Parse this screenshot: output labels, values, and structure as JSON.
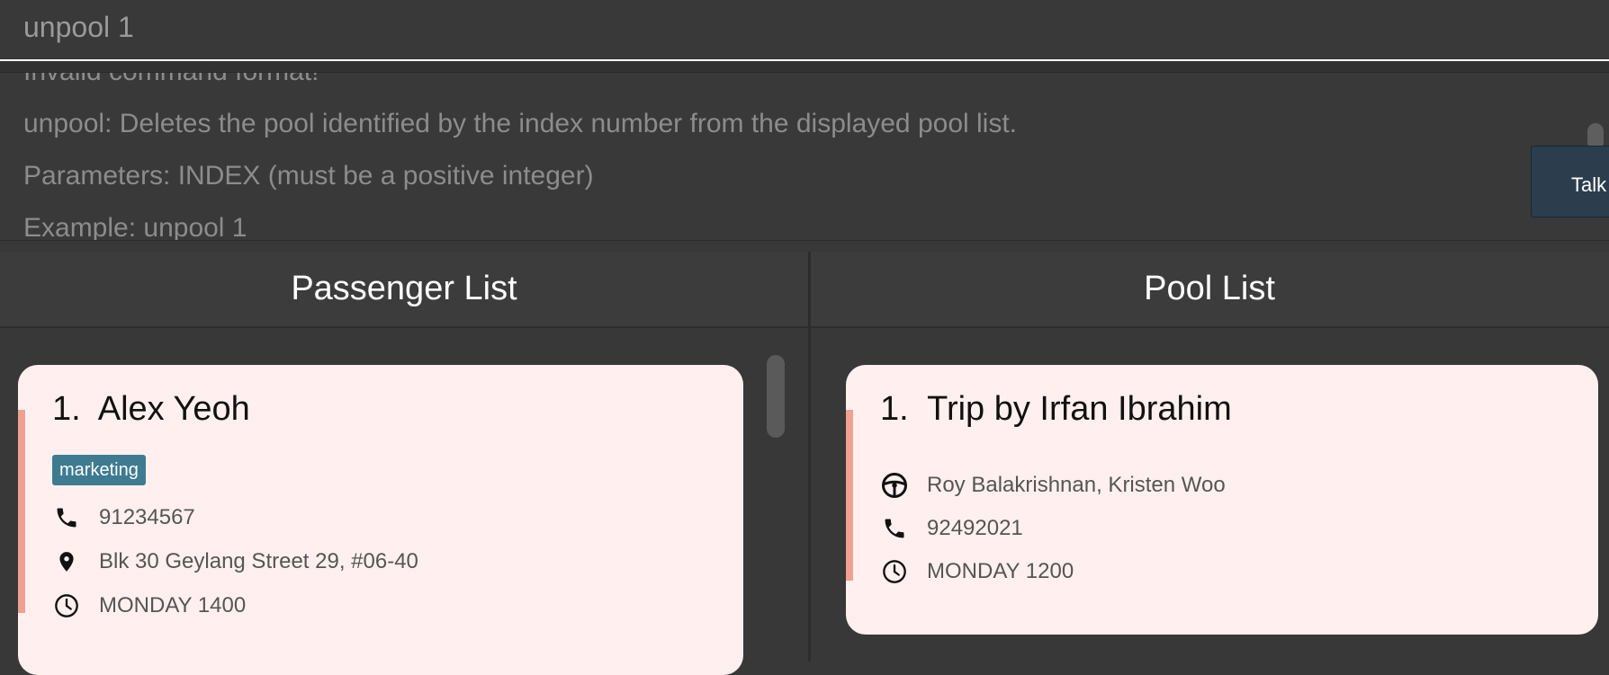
{
  "command_box": {
    "value": "unpool 1"
  },
  "result_display": {
    "lines": [
      "Invalid command format!",
      "unpool: Deletes the pool identified by the index number from the displayed pool list.",
      "Parameters: INDEX (must be a positive integer)",
      "Example: unpool 1"
    ]
  },
  "talk_button": {
    "label": "Talk"
  },
  "passenger_list": {
    "title": "Passenger List",
    "cards": [
      {
        "index": "1.",
        "name": "Alex Yeoh",
        "tag": "marketing",
        "phone": "91234567",
        "address": "Blk 30 Geylang Street 29, #06-40",
        "time": "MONDAY 1400",
        "icons": {
          "phone": "phone-icon",
          "address": "location-pin-icon",
          "time": "clock-icon"
        }
      }
    ]
  },
  "pool_list": {
    "title": "Pool List",
    "cards": [
      {
        "index": "1.",
        "title": "Trip by Irfan Ibrahim",
        "passengers": "Roy Balakrishnan, Kristen Woo",
        "phone": "92492021",
        "time": "MONDAY 1200",
        "icons": {
          "passengers": "steering-wheel-icon",
          "phone": "phone-icon",
          "time": "clock-icon"
        }
      }
    ]
  },
  "colors": {
    "background": "#383838",
    "card_background": "#fff0ef",
    "card_accent": "#f0a090",
    "tag_background": "#3e7b91",
    "talk_button": "#2c3e4d"
  }
}
